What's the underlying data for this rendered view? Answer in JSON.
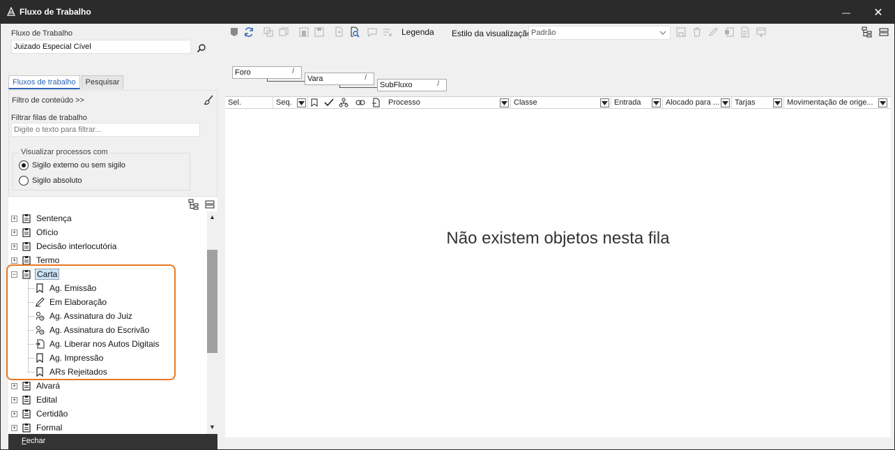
{
  "window": {
    "title": "Fluxo de Trabalho",
    "minimize_glyph": "—",
    "close_glyph": "✕"
  },
  "left": {
    "workflow_label": "Fluxo de Trabalho",
    "workflow_value": "Juizado Especial Cível",
    "tabs": [
      {
        "label": "Fluxos de trabalho",
        "active": true
      },
      {
        "label": "Pesquisar",
        "active": false
      }
    ],
    "content_filter": "Filtro de conteúdo >>",
    "filter_queues_label": "Filtrar filas de trabalho",
    "filter_placeholder": "Digite o texto para filtrar...",
    "visualize_group": "Visualizar processos com",
    "radio_options": [
      {
        "label": "Sigilo externo ou sem sigilo",
        "checked": true
      },
      {
        "label": "Sigilo absoluto",
        "checked": false
      }
    ],
    "tree": [
      {
        "label": "Sentença",
        "level": 0,
        "expander": "+",
        "icon": "clipboard-icon"
      },
      {
        "label": "Ofício",
        "level": 0,
        "expander": "+",
        "icon": "clipboard-icon"
      },
      {
        "label": "Decisão interlocutória",
        "level": 0,
        "expander": "+",
        "icon": "clipboard-icon"
      },
      {
        "label": "Termo",
        "level": 0,
        "expander": "+",
        "icon": "clipboard-icon"
      },
      {
        "label": "Carta",
        "level": 0,
        "expander": "−",
        "icon": "clipboard-icon",
        "selected": true
      },
      {
        "label": "Ag. Emissão",
        "level": 1,
        "icon": "document-flag-icon"
      },
      {
        "label": "Em Elaboração",
        "level": 1,
        "icon": "pen-icon"
      },
      {
        "label": "Ag. Assinatura do Juiz",
        "level": 1,
        "icon": "signature-clock-icon"
      },
      {
        "label": "Ag. Assinatura do Escrivão",
        "level": 1,
        "icon": "signature-clock-icon"
      },
      {
        "label": "Ag. Liberar nos Autos Digitais",
        "level": 1,
        "icon": "release-document-icon"
      },
      {
        "label": "Ag. Impressão",
        "level": 1,
        "icon": "document-flag-icon"
      },
      {
        "label": "ARs Rejeitados",
        "level": 1,
        "icon": "document-flag-icon"
      },
      {
        "label": "Alvará",
        "level": 0,
        "expander": "+",
        "icon": "clipboard-icon"
      },
      {
        "label": "Edital",
        "level": 0,
        "expander": "+",
        "icon": "clipboard-icon"
      },
      {
        "label": "Certidão",
        "level": 0,
        "expander": "+",
        "icon": "clipboard-icon"
      },
      {
        "label": "Formal",
        "level": 0,
        "expander": "+",
        "icon": "clipboard-icon"
      }
    ],
    "footer_close_underlined": "F",
    "footer_close_rest": "echar"
  },
  "toolbar": {
    "legend": "Legenda",
    "view_style_label": "Estilo da visualização",
    "view_style_value": "Padrão"
  },
  "grouping": [
    {
      "label": "Foro",
      "sort": "/"
    },
    {
      "label": "Vara",
      "sort": "/"
    },
    {
      "label": "SubFluxo",
      "sort": "/"
    }
  ],
  "grid": {
    "columns": {
      "sel": "Sel.",
      "seq": "Seq.",
      "processo": "Processo",
      "classe": "Classe",
      "entrada": "Entrada",
      "alocado": "Alocado para ...",
      "tarjas": "Tarjas",
      "movimentacao": "Movimentação de orige..."
    },
    "empty_message": "Não existem objetos nesta fila"
  },
  "colors": {
    "titlebar": "#2b2b2b",
    "accent_tab": "#2c64b5",
    "highlight": "#e87722",
    "selection": "#cce4f7"
  }
}
